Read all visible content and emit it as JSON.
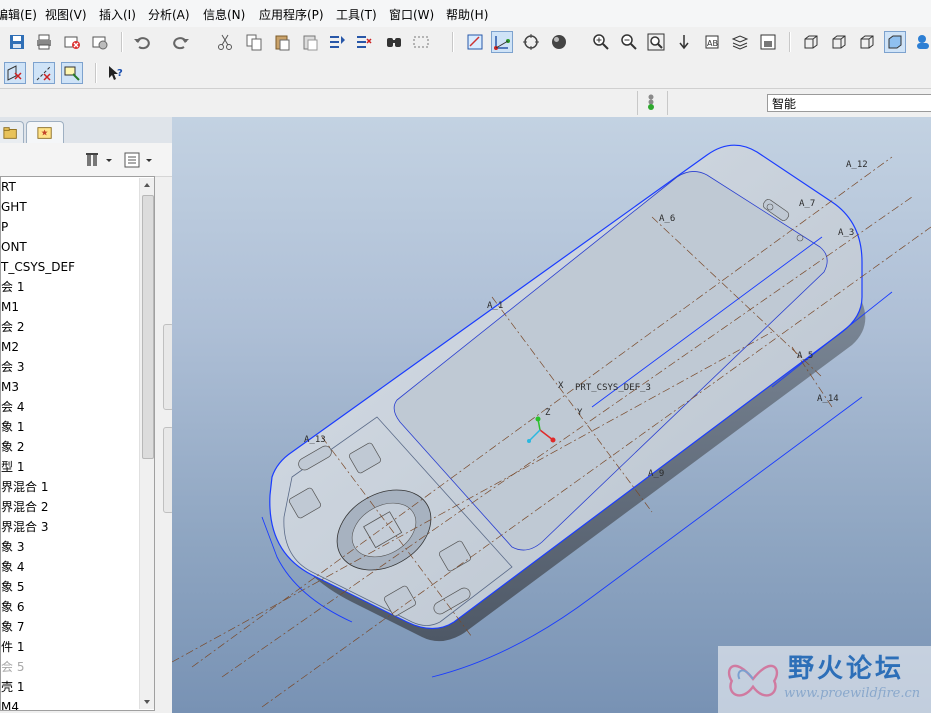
{
  "menu": {
    "items": [
      "编辑(E)",
      "视图(V)",
      "插入(I)",
      "分析(A)",
      "信息(N)",
      "应用程序(P)",
      "工具(T)",
      "窗口(W)",
      "帮助(H)"
    ]
  },
  "toolbar": {
    "row1": [
      "save-icon",
      "print-icon",
      "close-window-icon",
      "erase-icon",
      "undo-icon",
      "redo-icon",
      "cut-icon",
      "copy-icon",
      "paste-icon",
      "paste-special-icon",
      "regenerate-icon",
      "regen-manager-icon",
      "find-icon",
      "select-box-icon",
      "repaint-icon",
      "spin-center-icon",
      "orient-icon",
      "shading-icon",
      "zoom-in-icon",
      "zoom-out-icon",
      "refit-icon",
      "reorient-icon",
      "saved-views-icon",
      "layers-icon",
      "view-manager-icon",
      "wireframe-icon",
      "hidden-line-icon",
      "no-hidden-icon",
      "shaded-icon"
    ],
    "row2": [
      "datum-plane-toggle-icon",
      "datum-axis-toggle-icon",
      "datum-point-toggle-icon",
      "csys-toggle-icon",
      "whats-this-icon"
    ]
  },
  "status": {
    "filter_value": "智能"
  },
  "model_tree": {
    "items": [
      {
        "label": "RT"
      },
      {
        "label": "GHT"
      },
      {
        "label": "P"
      },
      {
        "label": "ONT"
      },
      {
        "label": "T_CSYS_DEF"
      },
      {
        "label": "会 1"
      },
      {
        "label": "M1"
      },
      {
        "label": "会 2"
      },
      {
        "label": "M2"
      },
      {
        "label": "会 3"
      },
      {
        "label": "M3"
      },
      {
        "label": "会 4"
      },
      {
        "label": "象 1"
      },
      {
        "label": "象 2"
      },
      {
        "label": "型 1"
      },
      {
        "label": "界混合 1"
      },
      {
        "label": "界混合 2"
      },
      {
        "label": "界混合 3"
      },
      {
        "label": "象 3"
      },
      {
        "label": "象 4"
      },
      {
        "label": "象 5"
      },
      {
        "label": "象 6"
      },
      {
        "label": "象 7"
      },
      {
        "label": "件 1"
      },
      {
        "label": "会 5",
        "dim": true
      },
      {
        "label": "壳 1"
      },
      {
        "label": "M4"
      }
    ]
  },
  "viewport": {
    "datum_labels": [
      "A_12",
      "A_7",
      "A_3",
      "A_6",
      "A_1",
      "PRT_CSYS_DEF_3",
      "A_5",
      "A_14",
      "A_13",
      "A_9",
      "A_8"
    ],
    "csys_axis_labels": [
      "X",
      "Y",
      "Z"
    ]
  },
  "watermark": {
    "title": "野火论坛",
    "url": "www.proewildfire.cn"
  },
  "colors": {
    "model_body": "#c9d2dc",
    "edge_highlight": "#1a3cff",
    "datum": "#8a5a3a",
    "viewport_bg": "#9fb3cc"
  }
}
